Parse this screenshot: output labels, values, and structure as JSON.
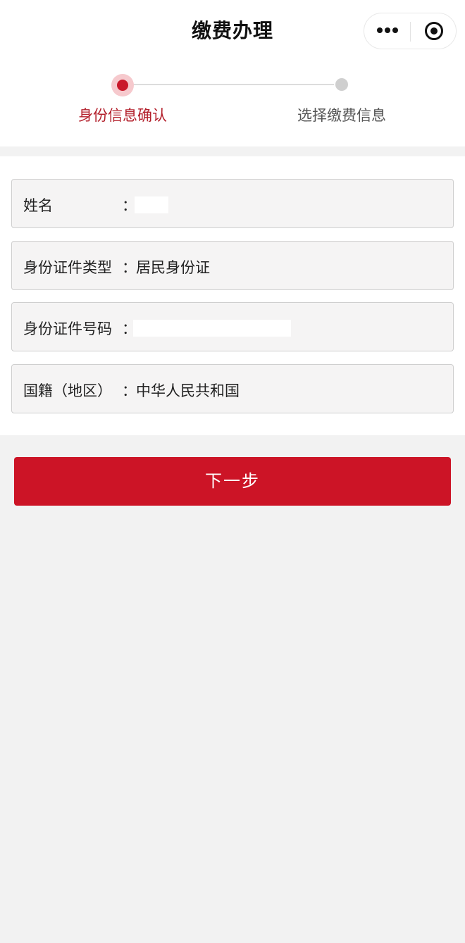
{
  "header": {
    "title": "缴费办理",
    "more_label": "更多",
    "close_label": "关闭"
  },
  "steps": [
    {
      "label": "身份信息确认",
      "active": true
    },
    {
      "label": "选择缴费信息",
      "active": false
    }
  ],
  "form": {
    "fields": [
      {
        "label": "姓名",
        "colon": "：",
        "value": ""
      },
      {
        "label": "身份证件类型",
        "colon": "：",
        "value": "居民身份证"
      },
      {
        "label": "身份证件号码",
        "colon": "：",
        "value": ""
      },
      {
        "label": "国籍（地区）",
        "colon": "：",
        "value": "中华人民共和国"
      }
    ]
  },
  "actions": {
    "next_label": "下一步"
  },
  "colors": {
    "accent": "#cc1426",
    "step_active_text": "#b3202c",
    "background": "#f2f2f2"
  }
}
